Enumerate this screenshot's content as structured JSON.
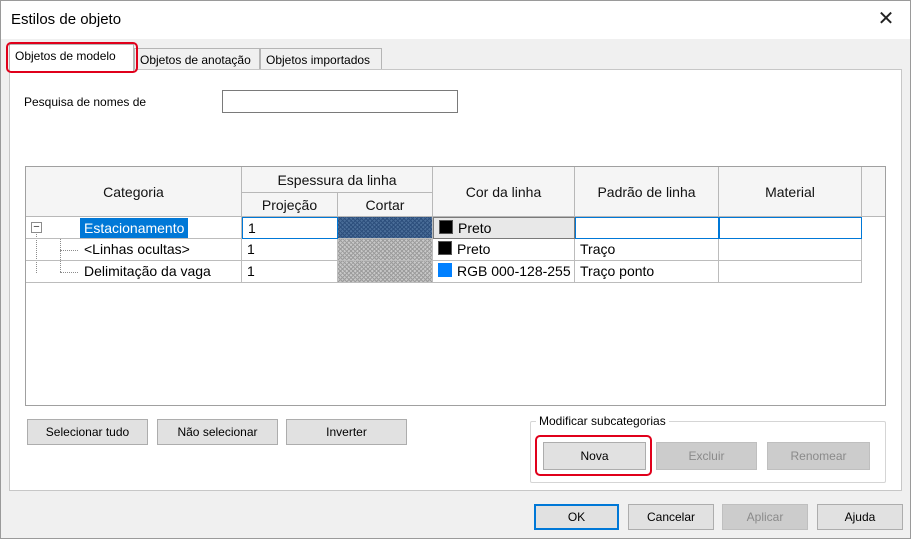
{
  "window": {
    "title": "Estilos de objeto"
  },
  "tabs": [
    {
      "label": "Objetos de modelo"
    },
    {
      "label": "Objetos de anotação"
    },
    {
      "label": "Objetos importados"
    }
  ],
  "search": {
    "label": "Pesquisa de nomes de",
    "value": ""
  },
  "table": {
    "headers": {
      "categoria": "Categoria",
      "espessura": "Espessura da linha",
      "projecao": "Projeção",
      "cortar": "Cortar",
      "cor": "Cor da linha",
      "padrao": "Padrão de linha",
      "material": "Material"
    },
    "rows": [
      {
        "name": "Estacionamento",
        "projection": "1",
        "color_name": "Preto",
        "color_hex": "#000000",
        "pattern": "",
        "material": "",
        "selected": true
      },
      {
        "name": "<Linhas ocultas>",
        "projection": "1",
        "color_name": "Preto",
        "color_hex": "#000000",
        "pattern": "Traço",
        "material": ""
      },
      {
        "name": "Delimitação da vaga",
        "projection": "1",
        "color_name": "RGB 000-128-255",
        "color_hex": "#0080ff",
        "pattern": "Traço ponto",
        "material": ""
      }
    ]
  },
  "selection_buttons": {
    "select_all": "Selecionar tudo",
    "select_none": "Não selecionar",
    "invert": "Inverter"
  },
  "subcategories": {
    "group_label": "Modificar subcategorias",
    "new": "Nova",
    "delete": "Excluir",
    "rename": "Renomear"
  },
  "footer": {
    "ok": "OK",
    "cancel": "Cancelar",
    "apply": "Aplicar",
    "help": "Ajuda"
  },
  "colors": {
    "accent": "#0078d7",
    "highlight": "#e0001b"
  }
}
